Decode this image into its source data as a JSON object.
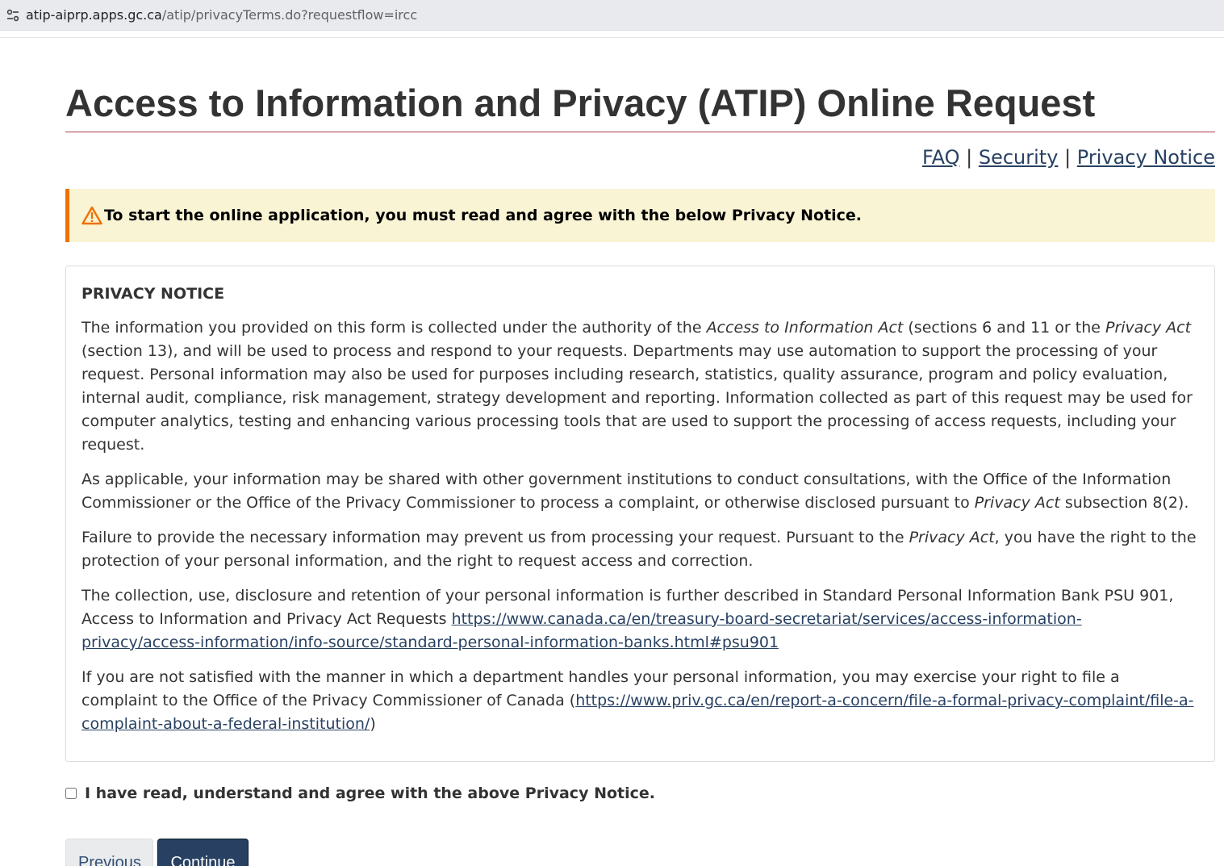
{
  "browser": {
    "url_host": "atip-aiprp.apps.gc.ca",
    "url_path": "/atip/privacyTerms.do?requestflow=ircc"
  },
  "header": {
    "title": "Access to Information and Privacy (ATIP) Online Request"
  },
  "toplinks": {
    "faq": "FAQ",
    "separator": "|",
    "security": "Security",
    "privacy_notice": "Privacy Notice"
  },
  "warning": {
    "icon": "warning-triangle-icon",
    "text": "To start the online application, you must read and agree with the below Privacy Notice."
  },
  "notice": {
    "heading": "PRIVACY NOTICE",
    "p1": {
      "a": "The information you provided on this form is collected under the authority of the ",
      "act1": "Access to Information Act",
      "b": " (sections 6 and 11 or the ",
      "act2": "Privacy Act",
      "c": " (section 13), and will be used to process and respond to your requests. Departments may use automation to support the processing of your request. Personal information may also be used for purposes including research, statistics, quality assurance, program and policy evaluation, internal audit, compliance, risk management, strategy development and reporting. Information collected as part of this request may be used for computer analytics, testing and enhancing various processing tools that are used to support the processing of access requests, including your request."
    },
    "p2": {
      "a": "As applicable, your information may be shared with other government institutions to conduct consultations, with the Office of the Information Commissioner or the Office of the Privacy Commissioner to process a complaint, or otherwise disclosed pursuant to ",
      "act": "Privacy Act",
      "b": " subsection 8(2)."
    },
    "p3": {
      "a": "Failure to provide the necessary information may prevent us from processing your request. Pursuant to the ",
      "act": "Privacy Act",
      "b": ", you have the right to the protection of your personal information, and the right to request access and correction."
    },
    "p4": {
      "a": "The collection, use, disclosure and retention of your personal information is further described in Standard Personal Information Bank PSU 901, Access to Information and Privacy Act Requests ",
      "link": "https://www.canada.ca/en/treasury-board-secretariat/services/access-information-privacy/access-information/info-source/standard-personal-information-banks.html#psu901"
    },
    "p5": {
      "a": "If you are not satisfied with the manner in which a department handles your personal information, you may exercise your right to file a complaint to the Office of the Privacy Commissioner of Canada (",
      "link": "https://www.priv.gc.ca/en/report-a-concern/file-a-formal-privacy-complaint/file-a-complaint-about-a-federal-institution/",
      "b": ")"
    }
  },
  "agreement": {
    "label": "I have read, understand and agree with the above Privacy Notice.",
    "checked": false
  },
  "buttons": {
    "previous": "Previous",
    "continue": "Continue"
  },
  "colors": {
    "link": "#284162",
    "title_rule": "#af3c43",
    "warning_bg": "#f9f4d4",
    "warning_border": "#ee7100",
    "continue_bg": "#284162"
  }
}
